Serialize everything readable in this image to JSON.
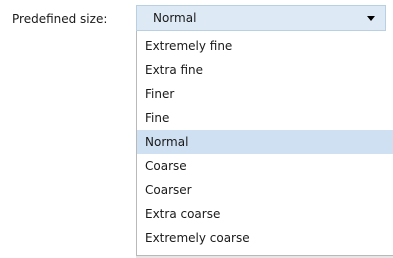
{
  "form": {
    "label": "Predefined size:",
    "selected_value": "Normal",
    "arrow_icon": "triangle-down-icon"
  },
  "dropdown": {
    "items": [
      {
        "label": "Extremely fine"
      },
      {
        "label": "Extra fine"
      },
      {
        "label": "Finer"
      },
      {
        "label": "Fine"
      },
      {
        "label": "Normal",
        "selected": true
      },
      {
        "label": "Coarse"
      },
      {
        "label": "Coarser"
      },
      {
        "label": "Extra coarse"
      },
      {
        "label": "Extremely coarse"
      }
    ],
    "highlight_color": "#cfe0f2"
  },
  "colors": {
    "select_background": "#ddeaf6",
    "select_border": "#b9cfe4",
    "list_border": "#b9b9b9"
  }
}
